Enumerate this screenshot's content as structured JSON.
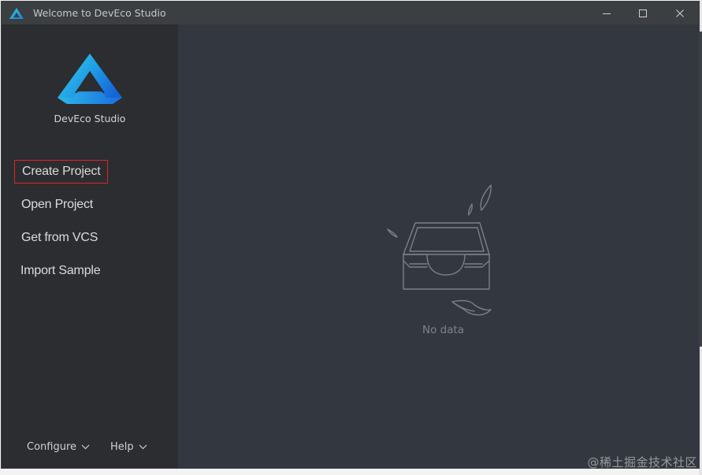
{
  "window": {
    "title": "Welcome to DevEco Studio"
  },
  "sidebar": {
    "logo_text": "DevEco Studio",
    "items": [
      {
        "label": "Create Project",
        "selected": true
      },
      {
        "label": "Open Project",
        "selected": false
      },
      {
        "label": "Get from VCS",
        "selected": false
      },
      {
        "label": "Import Sample",
        "selected": false
      }
    ],
    "footer": {
      "configure_label": "Configure",
      "help_label": "Help"
    }
  },
  "main": {
    "empty_text": "No data"
  },
  "watermark": "@稀土掘金技术社区",
  "colors": {
    "sidebar_bg": "#2b2d30",
    "main_bg": "#333840",
    "titlebar_bg": "#3c3f41",
    "selection_border": "#e0222a",
    "logo_blue": "#1f8fe0",
    "logo_cyan": "#2ec6d8"
  },
  "icons": {
    "app": "deveco-logo-icon",
    "minimize": "minimize-icon",
    "maximize": "maximize-icon",
    "close": "close-icon",
    "chevron": "chevron-down-icon",
    "empty": "empty-inbox-icon"
  }
}
